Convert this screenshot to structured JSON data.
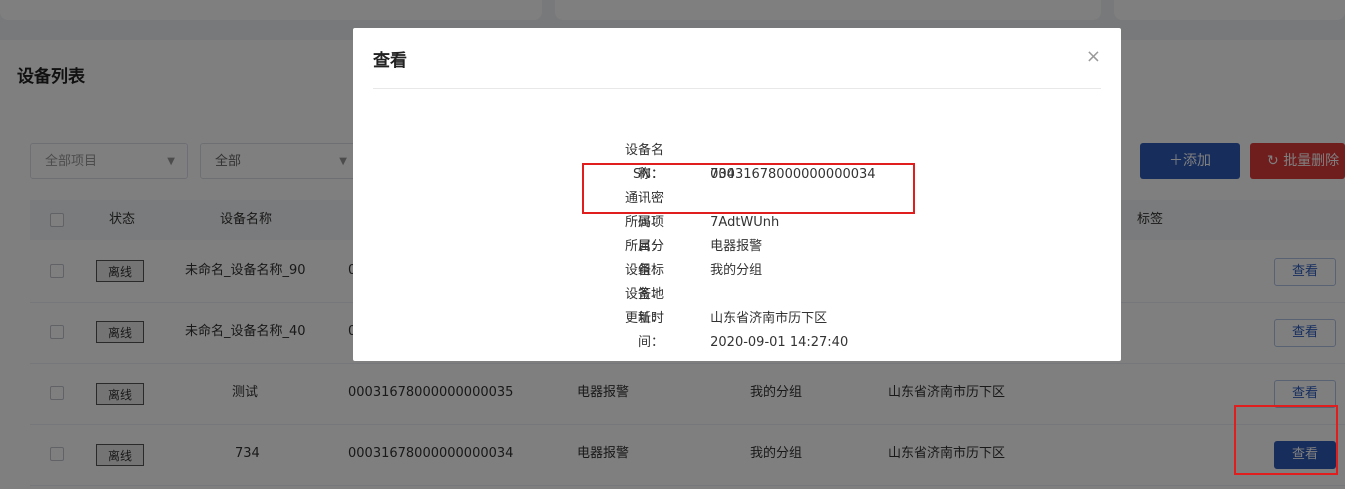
{
  "page": {
    "title": "设备列表"
  },
  "filters": [
    {
      "value": "全部项目"
    },
    {
      "value": "全部"
    }
  ],
  "actions": {
    "add": "添加",
    "batch_delete": "批量删除"
  },
  "table": {
    "headers": [
      "状态",
      "设备名称",
      "标签"
    ],
    "rows": [
      {
        "status": "离线",
        "name": "未命名_设备名称_90",
        "sn": "0",
        "project": "",
        "group": "",
        "address": "",
        "view": "查看"
      },
      {
        "status": "离线",
        "name": "未命名_设备名称_40",
        "sn": "0",
        "project": "",
        "group": "",
        "address": "",
        "view": "查看"
      },
      {
        "status": "离线",
        "name": "测试",
        "sn": "00031678000000000035",
        "project": "电器报警",
        "group": "我的分组",
        "address": "山东省济南市历下区",
        "view": "查看"
      },
      {
        "status": "离线",
        "name": "734",
        "sn": "00031678000000000034",
        "project": "电器报警",
        "group": "我的分组",
        "address": "山东省济南市历下区",
        "view": "查看"
      }
    ]
  },
  "modal": {
    "title": "查看",
    "close_icon": "×",
    "fields": [
      {
        "label": "设备名称：",
        "value": "734"
      },
      {
        "label": "SN：",
        "value": "00031678000000000034"
      },
      {
        "label": "通讯密码：",
        "value": "7AdtWUnh"
      },
      {
        "label": "所属项目：",
        "value": "电器报警"
      },
      {
        "label": "所属分组：",
        "value": "我的分组"
      },
      {
        "label": "设备标签：",
        "value": ""
      },
      {
        "label": "设备地址：",
        "value": "山东省济南市历下区"
      },
      {
        "label": "更新时间：",
        "value": "2020-09-01 14:27:40"
      }
    ]
  },
  "colors": {
    "primary": "#2f5bb8",
    "danger": "#e03b3b",
    "highlight": "#e01e1e"
  }
}
